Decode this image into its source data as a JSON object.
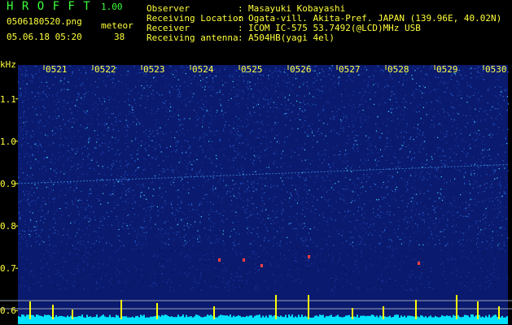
{
  "app": {
    "name": "H R O F F T",
    "version": "1.00"
  },
  "file": {
    "name": "0506180520.png",
    "datetime": "05.06.18 05:20"
  },
  "detection": {
    "label": "meteor",
    "count": "38"
  },
  "info": [
    {
      "label": "Observer",
      "sep": ":",
      "value": "Masayuki Kobayashi"
    },
    {
      "label": "Receiving Location",
      "sep": ":",
      "value": "Ogata-vill. Akita-Pref. JAPAN (139.96E, 40.02N)"
    },
    {
      "label": "Receiver",
      "sep": ":",
      "value": "ICOM IC-575 53.7492(@LCD)MHz USB"
    },
    {
      "label": "Receiving antenna",
      "sep": ":",
      "value": "A504HB(yagi 4el)"
    }
  ],
  "chart_data": {
    "type": "heatmap",
    "ylabel": "kHz",
    "y_ticks": [
      "1.1",
      "1.0",
      "0.9",
      "0.8",
      "0.7",
      "0.6"
    ],
    "x_ticks": [
      "0521",
      "0522",
      "0523",
      "0524",
      "0525",
      "0526",
      "0527",
      "0528",
      "0529",
      "0530"
    ],
    "ylim": [
      0.57,
      1.18
    ],
    "colors": {
      "background": "#0a1a6e",
      "noise_high": "#40e0ff",
      "meteor": "#ff4040",
      "tick_text": "#ffff3c",
      "baseline": "#00e0ff",
      "peaks": "#ffff00"
    }
  }
}
